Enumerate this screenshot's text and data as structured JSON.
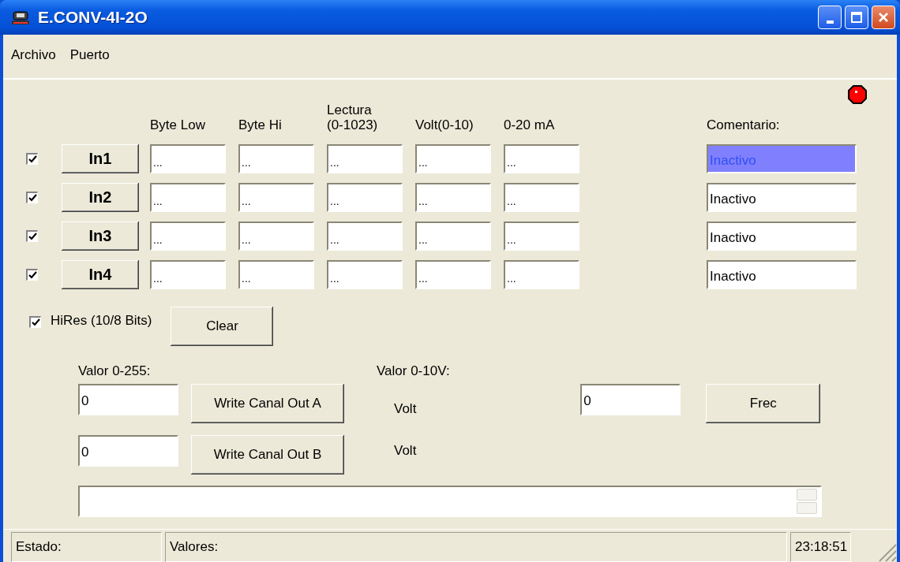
{
  "window": {
    "title": "E.CONV-4I-2O"
  },
  "menu": [
    "Archivo",
    "Puerto"
  ],
  "connection": {
    "connected": false
  },
  "columns": [
    "Byte Low",
    "Byte Hi",
    "Lectura\n(0-1023)",
    "Volt(0-10)",
    "0-20 mA"
  ],
  "comment_header": "Comentario:",
  "channels": [
    {
      "enabled": true,
      "button": "In1",
      "values": [
        "...",
        "...",
        "...",
        "...",
        "..."
      ],
      "comment": "Inactivo",
      "selected": true
    },
    {
      "enabled": true,
      "button": "In2",
      "values": [
        "...",
        "...",
        "...",
        "...",
        "..."
      ],
      "comment": "Inactivo",
      "selected": false
    },
    {
      "enabled": true,
      "button": "In3",
      "values": [
        "...",
        "...",
        "...",
        "...",
        "..."
      ],
      "comment": "Inactivo",
      "selected": false
    },
    {
      "enabled": true,
      "button": "In4",
      "values": [
        "...",
        "...",
        "...",
        "...",
        "..."
      ],
      "comment": "Inactivo",
      "selected": false
    }
  ],
  "hires": {
    "checked": true,
    "label": "HiRes (10/8 Bits)"
  },
  "clear_button": "Clear",
  "output": {
    "value_label": "Valor 0-255:",
    "volt_label": "Valor 0-10V:",
    "channels": [
      {
        "value": "0",
        "button": "Write Canal Out A",
        "unit": "Volt"
      },
      {
        "value": "0",
        "button": "Write Canal Out B",
        "unit": "Volt"
      }
    ],
    "frequency": {
      "value": "0",
      "button": "Frec"
    }
  },
  "status_bar": [
    "Estado:",
    "Valores:",
    "23:18:51"
  ]
}
